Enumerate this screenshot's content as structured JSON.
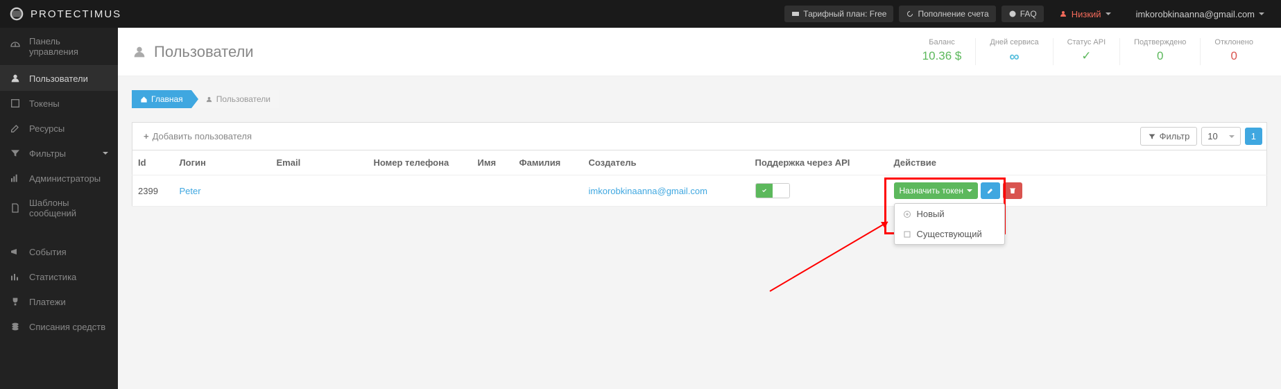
{
  "brand": "PROTECTIMUS",
  "topbar": {
    "tariff": "Тарифный план: Free",
    "topup": "Пополнение счета",
    "faq": "FAQ",
    "risk": "Низкий",
    "email": "imkorobkinaanna@gmail.com"
  },
  "sidebar": {
    "items": [
      {
        "label": "Панель управления"
      },
      {
        "label": "Пользователи"
      },
      {
        "label": "Токены"
      },
      {
        "label": "Ресурсы"
      },
      {
        "label": "Фильтры"
      },
      {
        "label": "Администраторы"
      },
      {
        "label": "Шаблоны сообщений"
      },
      {
        "label": "События"
      },
      {
        "label": "Статистика"
      },
      {
        "label": "Платежи"
      },
      {
        "label": "Списания средств"
      }
    ]
  },
  "page": {
    "title": "Пользователи"
  },
  "stats": {
    "balance_label": "Баланс",
    "balance_val": "10.36 $",
    "days_label": "Дней сервиса",
    "api_label": "Статус API",
    "confirmed_label": "Подтверждено",
    "confirmed_val": "0",
    "rejected_label": "Отклонено",
    "rejected_val": "0"
  },
  "breadcrumb": {
    "home": "Главная",
    "current": "Пользователи"
  },
  "toolbar": {
    "add": "Добавить пользователя",
    "filter": "Фильтр",
    "pagesize": "10",
    "page": "1"
  },
  "table": {
    "headers": {
      "id": "Id",
      "login": "Логин",
      "email": "Email",
      "phone": "Номер телефона",
      "name": "Имя",
      "surname": "Фамилия",
      "creator": "Создатель",
      "api": "Поддержка через API",
      "action": "Действие"
    },
    "rows": [
      {
        "id": "2399",
        "login": "Peter",
        "email": "",
        "phone": "",
        "name": "",
        "surname": "",
        "creator": "imkorobkinaanna@gmail.com"
      }
    ]
  },
  "actions": {
    "assign": "Назначить токен",
    "menu": {
      "new": "Новый",
      "existing": "Существующий"
    }
  }
}
